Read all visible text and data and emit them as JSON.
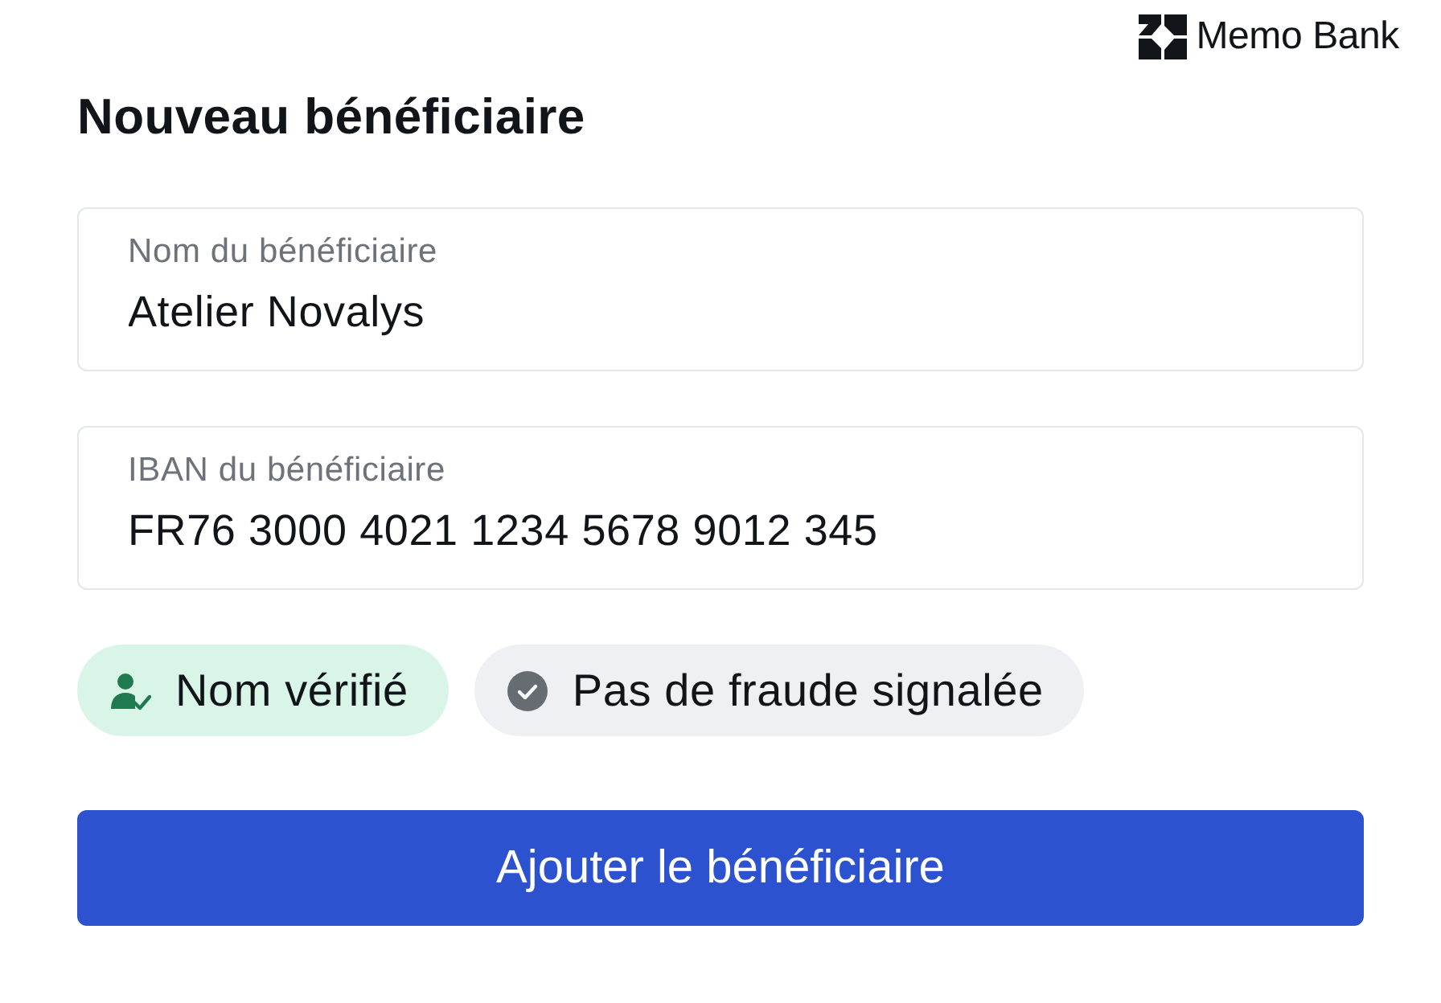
{
  "brand": {
    "name": "Memo Bank"
  },
  "title": "Nouveau bénéficiaire",
  "fields": [
    {
      "label": "Nom du bénéficiaire",
      "value": "Atelier Novalys"
    },
    {
      "label": "IBAN du bénéficiaire",
      "value": "FR76 3000 4021 1234 5678 9012 345"
    }
  ],
  "checks": [
    {
      "kind": "verified",
      "label": "Nom vérifié"
    },
    {
      "kind": "neutral",
      "label": "Pas de fraude signalée"
    }
  ],
  "submit": {
    "label": "Ajouter le bénéficiaire"
  }
}
